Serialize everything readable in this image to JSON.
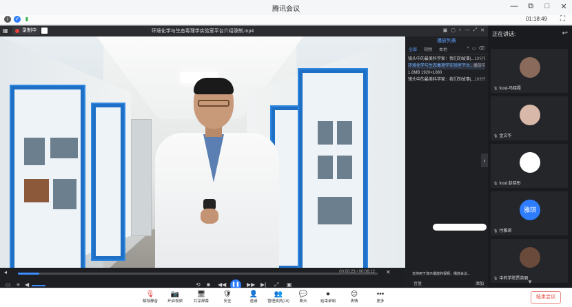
{
  "window": {
    "title": "腾讯会议",
    "controls": [
      "—",
      "⧉",
      "□",
      "✕"
    ]
  },
  "infobar": {
    "time": "01:18:49"
  },
  "video": {
    "recording_label": "录制中",
    "file_name": "环境化学与生态毒理学实验室平台介绍录制.mp4"
  },
  "playlist": {
    "title": "播放列表",
    "tabs": [
      "全部",
      "视频",
      "本地"
    ],
    "items": [
      {
        "name": "镜头中的最美科学家：我们的故事|...",
        "duration": "10分钟",
        "selected": false
      },
      {
        "name": "环境化学与生态毒理学实验室平台...",
        "duration": "播放中",
        "selected": true
      },
      {
        "name": "1.6MB   1920×1080",
        "duration": "",
        "selected": false
      },
      {
        "name": "镜头中的最美科学家：我们的故事|...",
        "duration": "10分钟",
        "selected": false
      }
    ],
    "tip": "支持用于演示播放的视频，播放会议...",
    "add_label": "添加",
    "bottom_left": "音量"
  },
  "controls": {
    "time_display": "00:00:23 / 00:06:12",
    "progress_fraction": 0.06
  },
  "side": {
    "speaking_label": "正在讲话:",
    "participants": [
      {
        "name": "food-马晓霞",
        "avatar_color": "#8a6a5a"
      },
      {
        "name": "金文华",
        "avatar_color": "#d8b8a8"
      },
      {
        "name": "food 赵晓彤",
        "avatar_color": "#ffffff"
      },
      {
        "name": "付雅琪",
        "avatar_text": "雅琪",
        "avatar_color": "#2f7dff"
      },
      {
        "name": "中药学院贾英丽",
        "avatar_color": "#6a4a3a"
      }
    ]
  },
  "toolbar": {
    "items": [
      {
        "icon": "🎙",
        "label": "解除静音"
      },
      {
        "icon": "📷",
        "label": "开启视频"
      },
      {
        "icon": "🖥",
        "label": "共享屏幕"
      },
      {
        "icon": "🛡",
        "label": "安全"
      },
      {
        "icon": "👤",
        "label": "邀请"
      },
      {
        "icon": "👥",
        "label": "管理成员(18)"
      },
      {
        "icon": "💬",
        "label": "聊天"
      },
      {
        "icon": "⏺",
        "label": "结束录制"
      },
      {
        "icon": "😊",
        "label": "表情"
      },
      {
        "icon": "•••",
        "label": "更多"
      }
    ],
    "end_label": "结束会议"
  }
}
